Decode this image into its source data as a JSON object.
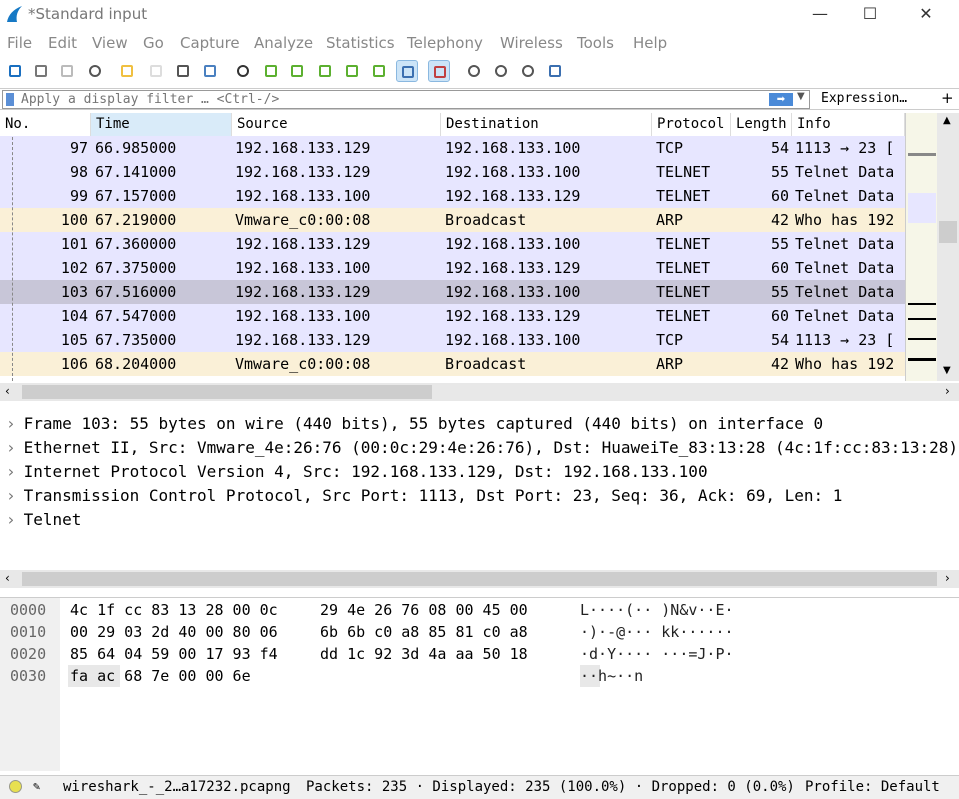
{
  "window": {
    "title": "*Standard input",
    "minimize": "—",
    "maximize": "☐",
    "close": "✕"
  },
  "menu": [
    "File",
    "Edit",
    "View",
    "Go",
    "Capture",
    "Analyze",
    "Statistics",
    "Telephony",
    "Wireless",
    "Tools",
    "Help"
  ],
  "toolbar": [
    "shark-fin-start-icon",
    "stop-icon",
    "restart-icon",
    "options-gear-icon",
    "open-folder-icon",
    "file-icon",
    "close-file-icon",
    "reload-icon",
    "find-icon",
    "back-arrow-icon",
    "forward-arrow-icon",
    "go-to-packet-icon",
    "first-packet-icon",
    "last-packet-icon",
    "autoscroll-icon",
    "colorize-icon",
    "zoom-in-icon",
    "zoom-out-icon",
    "zoom-normal-icon",
    "resize-columns-icon"
  ],
  "filter": {
    "placeholder": "Apply a display filter … <Ctrl-/>",
    "expression": "Expression…",
    "plus": "+"
  },
  "columns": [
    "No.",
    "Time",
    "Source",
    "Destination",
    "Protocol",
    "Length",
    "Info"
  ],
  "colors": {
    "tcp": "#e7e6ff",
    "arp": "#faf0d7",
    "selected": "#c8c6d8",
    "header_sorted": "#d9ebf9"
  },
  "packets": [
    {
      "no": "97",
      "time": "66.985000",
      "src": "192.168.133.129",
      "dst": "192.168.133.100",
      "proto": "TCP",
      "len": "54",
      "info": "1113 → 23 [",
      "kind": "tcp"
    },
    {
      "no": "98",
      "time": "67.141000",
      "src": "192.168.133.129",
      "dst": "192.168.133.100",
      "proto": "TELNET",
      "len": "55",
      "info": "Telnet Data",
      "kind": "tcp"
    },
    {
      "no": "99",
      "time": "67.157000",
      "src": "192.168.133.100",
      "dst": "192.168.133.129",
      "proto": "TELNET",
      "len": "60",
      "info": "Telnet Data",
      "kind": "tcp"
    },
    {
      "no": "100",
      "time": "67.219000",
      "src": "Vmware_c0:00:08",
      "dst": "Broadcast",
      "proto": "ARP",
      "len": "42",
      "info": "Who has 192",
      "kind": "arp"
    },
    {
      "no": "101",
      "time": "67.360000",
      "src": "192.168.133.129",
      "dst": "192.168.133.100",
      "proto": "TELNET",
      "len": "55",
      "info": "Telnet Data",
      "kind": "tcp"
    },
    {
      "no": "102",
      "time": "67.375000",
      "src": "192.168.133.100",
      "dst": "192.168.133.129",
      "proto": "TELNET",
      "len": "60",
      "info": "Telnet Data",
      "kind": "tcp"
    },
    {
      "no": "103",
      "time": "67.516000",
      "src": "192.168.133.129",
      "dst": "192.168.133.100",
      "proto": "TELNET",
      "len": "55",
      "info": "Telnet Data",
      "kind": "selected"
    },
    {
      "no": "104",
      "time": "67.547000",
      "src": "192.168.133.100",
      "dst": "192.168.133.129",
      "proto": "TELNET",
      "len": "60",
      "info": "Telnet Data",
      "kind": "tcp"
    },
    {
      "no": "105",
      "time": "67.735000",
      "src": "192.168.133.129",
      "dst": "192.168.133.100",
      "proto": "TCP",
      "len": "54",
      "info": "1113 → 23 [",
      "kind": "tcp"
    },
    {
      "no": "106",
      "time": "68.204000",
      "src": "Vmware_c0:00:08",
      "dst": "Broadcast",
      "proto": "ARP",
      "len": "42",
      "info": "Who has 192",
      "kind": "arp"
    }
  ],
  "details": [
    "Frame 103: 55 bytes on wire (440 bits), 55 bytes captured (440 bits) on interface 0",
    "Ethernet II, Src: Vmware_4e:26:76 (00:0c:29:4e:26:76), Dst: HuaweiTe_83:13:28 (4c:1f:cc:83:13:28)",
    "Internet Protocol Version 4, Src: 192.168.133.129, Dst: 192.168.133.100",
    "Transmission Control Protocol, Src Port: 1113, Dst Port: 23, Seq: 36, Ack: 69, Len: 1",
    "Telnet"
  ],
  "bytes": [
    {
      "offset": "0000",
      "hex1": "4c 1f cc 83 13 28 00 0c",
      "hex2": "29 4e 26 76 08 00 45 00",
      "ascii": "L····(·· )N&v··E·"
    },
    {
      "offset": "0010",
      "hex1": "00 29 03 2d 40 00 80 06",
      "hex2": "6b 6b c0 a8 85 81 c0 a8",
      "ascii": "·)·-@··· kk······"
    },
    {
      "offset": "0020",
      "hex1": "85 64 04 59 00 17 93 f4",
      "hex2": "dd 1c 92 3d 4a aa 50 18",
      "ascii": "·d·Y···· ···=J·P·"
    },
    {
      "offset": "0030",
      "hex1": "fa ac 68 7e 00 00 6e",
      "hex2": "",
      "ascii": "··h~··n"
    }
  ],
  "status": {
    "file": "wireshark_-_2…a17232.pcapng",
    "packets": "Packets: 235 · Displayed: 235 (100.0%) · Dropped: 0 (0.0%)",
    "profile": "Profile: Default"
  }
}
